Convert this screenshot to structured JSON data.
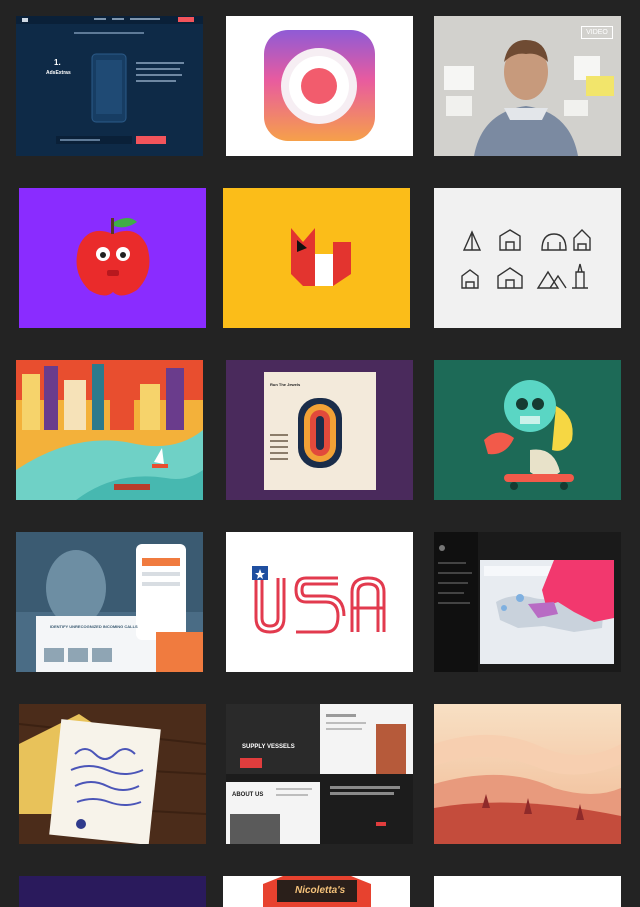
{
  "shots": [
    {
      "id": "landing-page",
      "bg": "#0e2a47",
      "accent": "#f2545b",
      "texts": {
        "number": "1.",
        "brand": "AdsExtras",
        "cta": "Sign up",
        "field": "Get started today"
      }
    },
    {
      "id": "camera-app-icon",
      "bg": "#ffffff",
      "accent": "#f25c6d"
    },
    {
      "id": "man-at-wall-photo",
      "bg": "#cfcfcc",
      "texts": {
        "badge": "VIDEO"
      }
    },
    {
      "id": "apple-character",
      "bg": "#8a2cff",
      "accent": "#ea2b2b"
    },
    {
      "id": "fox-logo",
      "bg": "#fbbd19",
      "accent": "#e3342f"
    },
    {
      "id": "building-icons",
      "bg": "#f1f1f1",
      "accent": "#333333"
    },
    {
      "id": "city-illustration",
      "bg": "#f3b13a",
      "accent": "#e84e2f"
    },
    {
      "id": "album-cover",
      "bg": "#4a2a5c",
      "accent": "#e9d7b8",
      "texts": {
        "title": "Run The Jewels"
      }
    },
    {
      "id": "skull-skater",
      "bg": "#1d6a57",
      "accent": "#5ad6c4"
    },
    {
      "id": "app-marketing-page",
      "bg": "#4a6c85",
      "accent": "#f07b3f",
      "texts": {
        "headline": "IDENTIFY UNRECOGNIZED INCOMING CALLS"
      }
    },
    {
      "id": "usa-lettering",
      "bg": "#ffffff",
      "accent": "#e23a4e",
      "texts": {
        "word": "USA"
      }
    },
    {
      "id": "dashboard-map",
      "bg": "#1a1a1a",
      "accent": "#f2386e"
    },
    {
      "id": "typography-card",
      "bg": "#4b2c1a",
      "accent": "#e8c25a"
    },
    {
      "id": "supply-vessels-site",
      "bg": "#1c1c1c",
      "accent": "#e13d3d",
      "texts": {
        "heading": "SUPPLY VESSELS",
        "about": "ABOUT US"
      }
    },
    {
      "id": "desert-landscape",
      "bg": "#f6d7b8",
      "accent": "#c44c3c"
    },
    {
      "id": "purple-shot",
      "bg": "#2a1a5c"
    },
    {
      "id": "nicoletta-badge",
      "bg": "#ffffff",
      "accent": "#e7422f",
      "texts": {
        "brand": "Nicoletta's"
      }
    },
    {
      "id": "blank-shot",
      "bg": "#ffffff"
    }
  ]
}
